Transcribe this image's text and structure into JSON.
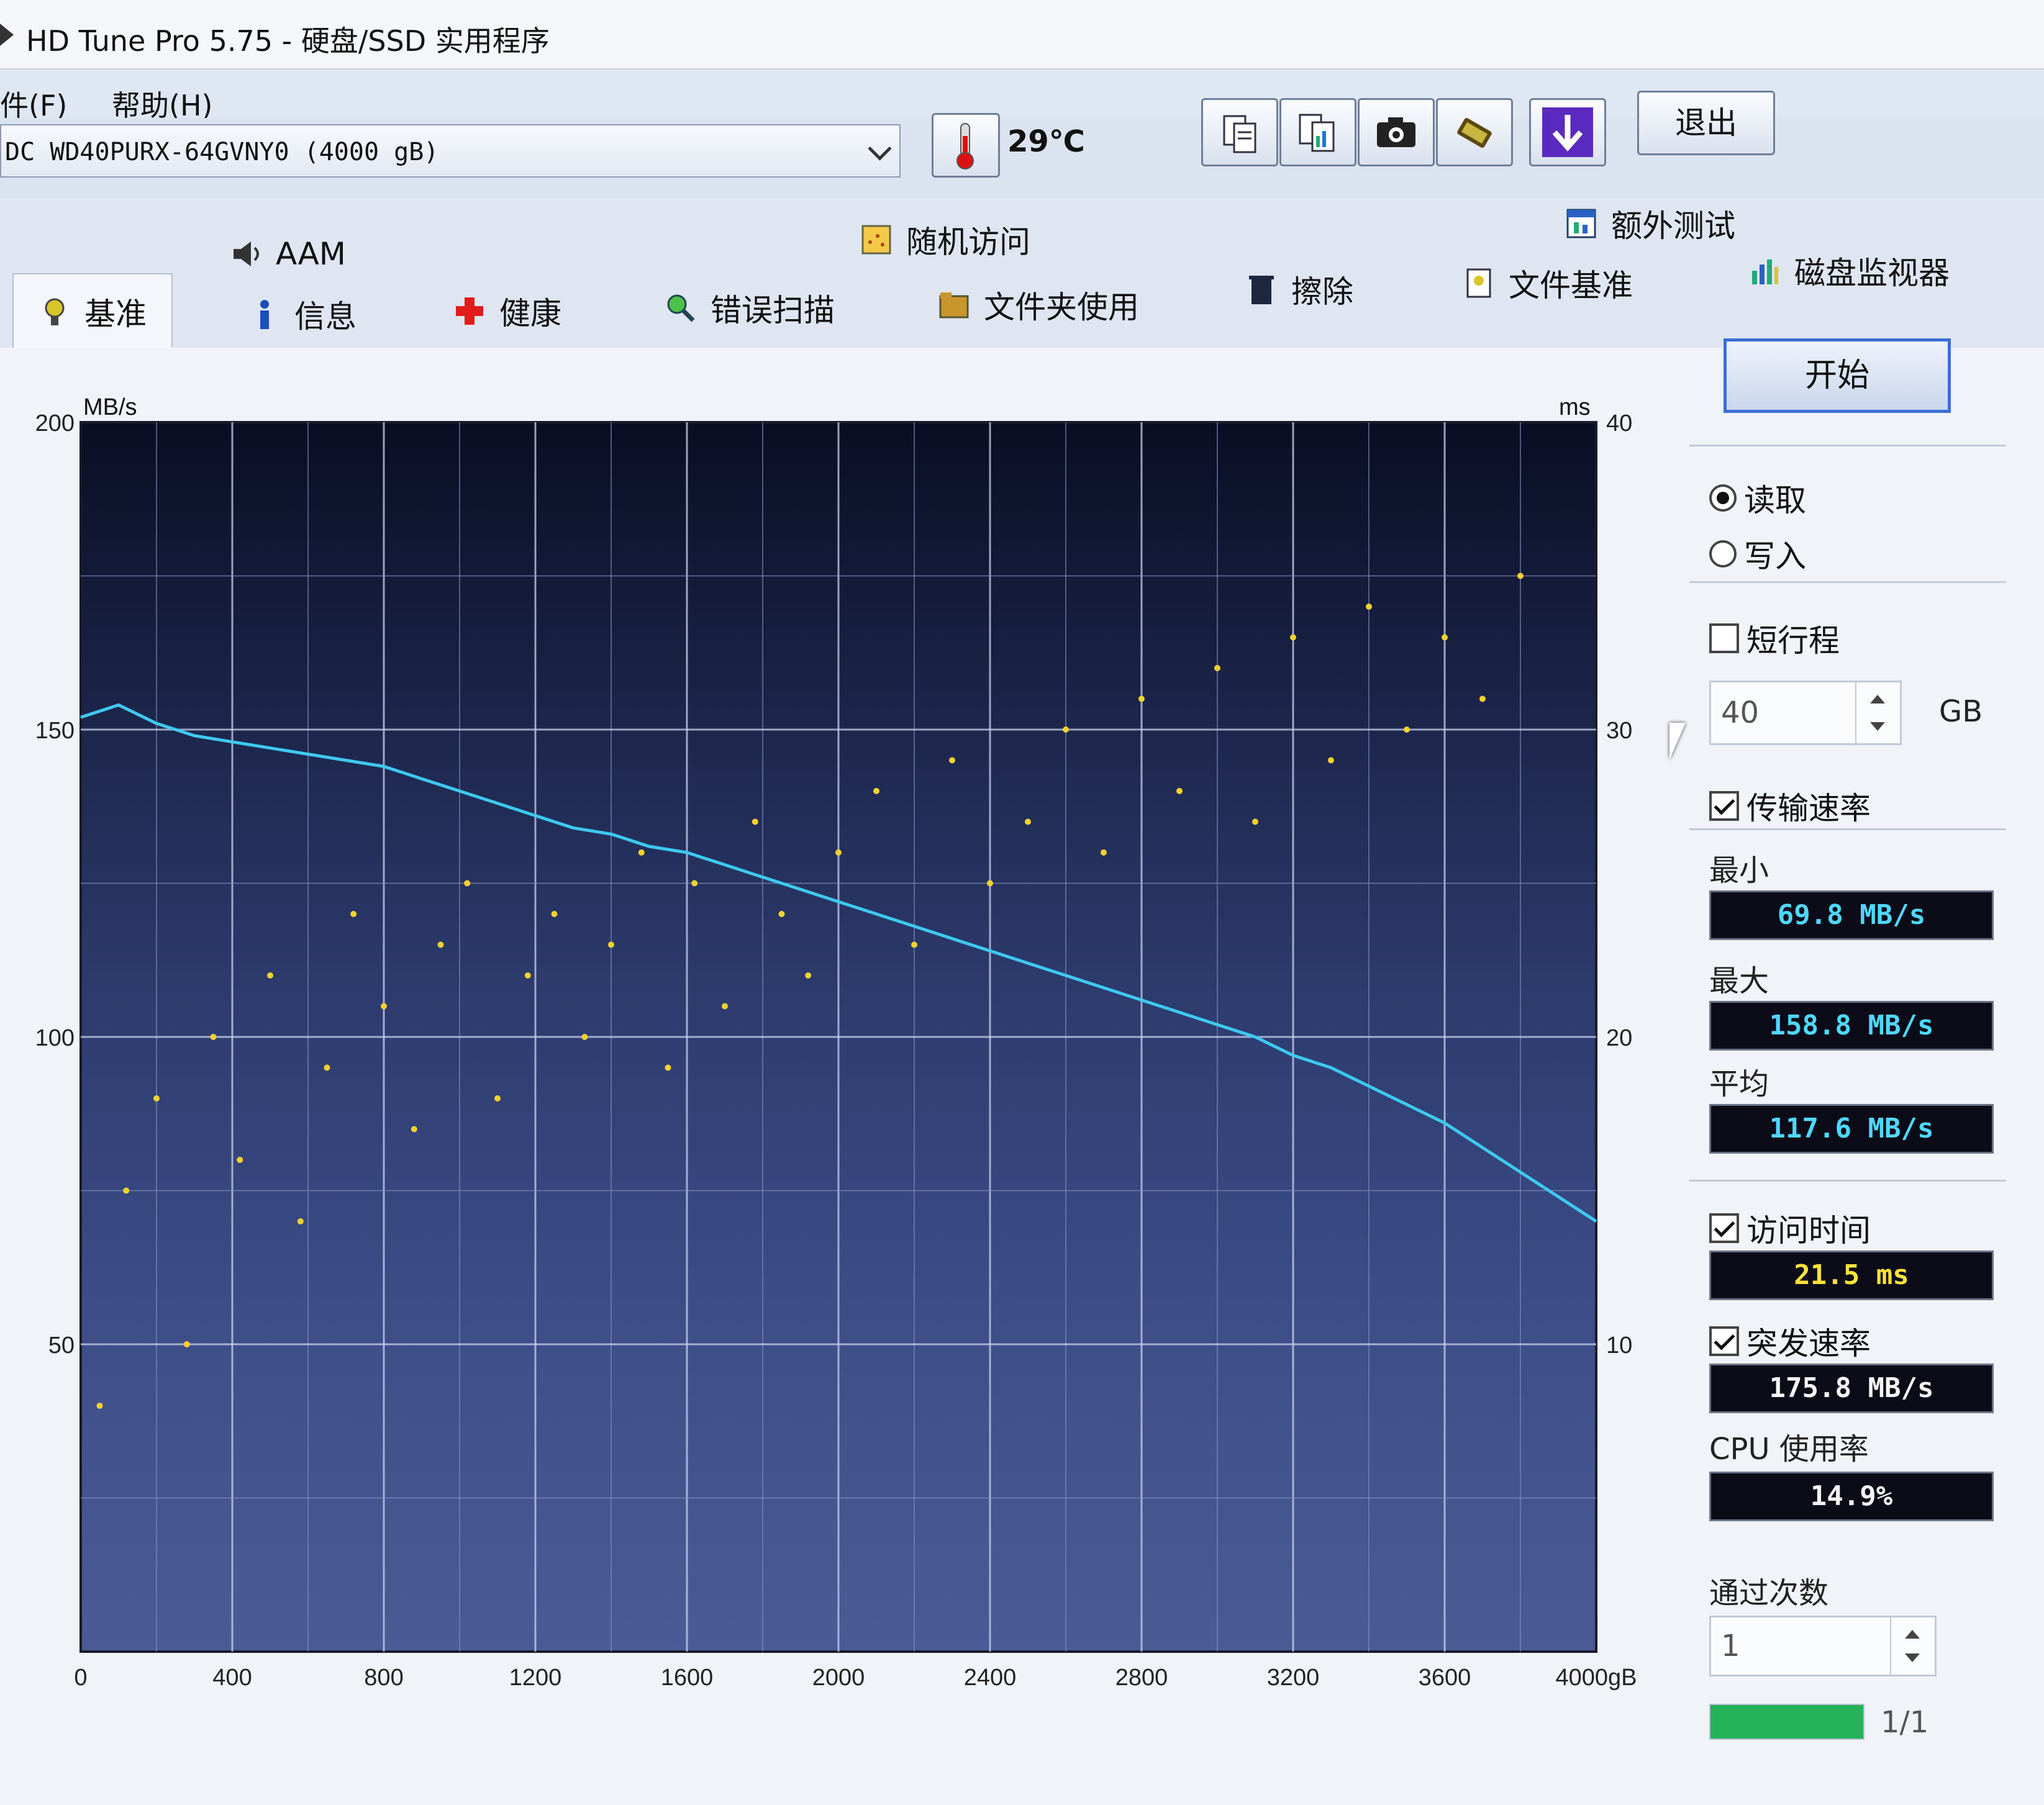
{
  "window": {
    "title": "HD Tune Pro 5.75 - 硬盘/SSD 实用程序"
  },
  "menu": {
    "file": "件(F)",
    "help": "帮助(H)"
  },
  "toolbar": {
    "drive": "DC WD40PURX-64GVNY0 (4000 gB)",
    "temperature": "29℃",
    "exit_label": "退出",
    "icons": [
      "copy-info-icon",
      "copy-all-icon",
      "screenshot-icon",
      "options-icon",
      "save-download-icon"
    ]
  },
  "tabs_top": [
    "AAM",
    "随机访问",
    "额外测试"
  ],
  "tabs_bottom": [
    "基准",
    "信息",
    "健康",
    "错误扫描",
    "文件夹使用",
    "擦除",
    "文件基准",
    "磁盘监视器"
  ],
  "active_tab": "基准",
  "side": {
    "start_label": "开始",
    "read_label": "读取",
    "write_label": "写入",
    "short_stroke_label": "短行程",
    "short_stroke_value": "40",
    "short_stroke_unit": "GB",
    "transfer_rate_label": "传输速率",
    "min_label": "最小",
    "min_value": "69.8 MB/s",
    "max_label": "最大",
    "max_value": "158.8 MB/s",
    "avg_label": "平均",
    "avg_value": "117.6 MB/s",
    "access_time_label": "访问时间",
    "access_time_value": "21.5 ms",
    "burst_rate_label": "突发速率",
    "burst_rate_value": "175.8 MB/s",
    "cpu_label": "CPU 使用率",
    "cpu_value": "14.9%",
    "passes_label": "通过次数",
    "passes_value": "1",
    "progress_text": "1/1",
    "progress_fraction": 1.0
  },
  "chart_data": {
    "type": "line",
    "left_axis_label": "MB/s",
    "right_axis_label": "ms",
    "x_unit": "gB",
    "ylim": [
      0,
      200
    ],
    "y2lim": [
      0,
      40
    ],
    "xlim": [
      0,
      4000
    ],
    "y_ticks": [
      "200",
      "150",
      "100",
      "50"
    ],
    "y2_ticks": [
      "40",
      "30",
      "20",
      "10"
    ],
    "x_ticks": [
      "0",
      "400",
      "800",
      "1200",
      "1600",
      "2000",
      "2400",
      "2800",
      "3200",
      "3600",
      "4000gB"
    ],
    "series": [
      {
        "kind": "transfer_rate",
        "color": "#3ec9f0",
        "x": [
          0,
          100,
          200,
          300,
          400,
          500,
          600,
          700,
          800,
          900,
          1000,
          1100,
          1200,
          1300,
          1400,
          1500,
          1600,
          1700,
          1800,
          1900,
          2000,
          2100,
          2200,
          2300,
          2400,
          2500,
          2600,
          2700,
          2800,
          2900,
          3000,
          3100,
          3200,
          3300,
          3400,
          3500,
          3600,
          3700,
          3800,
          3900,
          4000
        ],
        "values": [
          152,
          154,
          151,
          149,
          148,
          147,
          146,
          145,
          144,
          142,
          140,
          138,
          136,
          134,
          133,
          131,
          130,
          128,
          126,
          124,
          122,
          120,
          118,
          116,
          114,
          112,
          110,
          108,
          106,
          104,
          102,
          100,
          97,
          95,
          92,
          89,
          86,
          82,
          78,
          74,
          70
        ]
      },
      {
        "kind": "access_time",
        "color": "#f2d230",
        "style": "scatter",
        "x": [
          50,
          120,
          200,
          280,
          350,
          420,
          500,
          580,
          650,
          720,
          800,
          880,
          950,
          1020,
          1100,
          1180,
          1250,
          1330,
          1400,
          1480,
          1550,
          1620,
          1700,
          1780,
          1850,
          1920,
          2000,
          2100,
          2200,
          2300,
          2400,
          2500,
          2600,
          2700,
          2800,
          2900,
          3000,
          3100,
          3200,
          3300,
          3400,
          3500,
          3600,
          3700,
          3800
        ],
        "values": [
          8,
          15,
          18,
          10,
          20,
          16,
          22,
          14,
          19,
          24,
          21,
          17,
          23,
          25,
          18,
          22,
          24,
          20,
          23,
          26,
          19,
          25,
          21,
          27,
          24,
          22,
          26,
          28,
          23,
          29,
          25,
          27,
          30,
          26,
          31,
          28,
          32,
          27,
          33,
          29,
          34,
          30,
          33,
          31,
          35
        ]
      }
    ]
  }
}
